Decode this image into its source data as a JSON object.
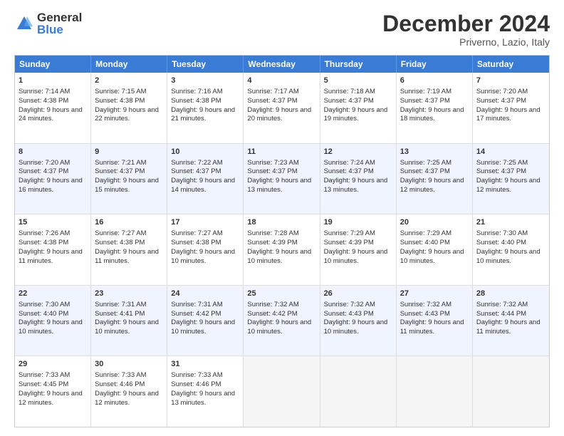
{
  "logo": {
    "general": "General",
    "blue": "Blue"
  },
  "title": "December 2024",
  "subtitle": "Priverno, Lazio, Italy",
  "headers": [
    "Sunday",
    "Monday",
    "Tuesday",
    "Wednesday",
    "Thursday",
    "Friday",
    "Saturday"
  ],
  "weeks": [
    [
      {
        "day": "1",
        "sunrise": "7:14 AM",
        "sunset": "4:38 PM",
        "daylight": "9 hours and 24 minutes."
      },
      {
        "day": "2",
        "sunrise": "7:15 AM",
        "sunset": "4:38 PM",
        "daylight": "9 hours and 22 minutes."
      },
      {
        "day": "3",
        "sunrise": "7:16 AM",
        "sunset": "4:38 PM",
        "daylight": "9 hours and 21 minutes."
      },
      {
        "day": "4",
        "sunrise": "7:17 AM",
        "sunset": "4:37 PM",
        "daylight": "9 hours and 20 minutes."
      },
      {
        "day": "5",
        "sunrise": "7:18 AM",
        "sunset": "4:37 PM",
        "daylight": "9 hours and 19 minutes."
      },
      {
        "day": "6",
        "sunrise": "7:19 AM",
        "sunset": "4:37 PM",
        "daylight": "9 hours and 18 minutes."
      },
      {
        "day": "7",
        "sunrise": "7:20 AM",
        "sunset": "4:37 PM",
        "daylight": "9 hours and 17 minutes."
      }
    ],
    [
      {
        "day": "8",
        "sunrise": "7:20 AM",
        "sunset": "4:37 PM",
        "daylight": "9 hours and 16 minutes."
      },
      {
        "day": "9",
        "sunrise": "7:21 AM",
        "sunset": "4:37 PM",
        "daylight": "9 hours and 15 minutes."
      },
      {
        "day": "10",
        "sunrise": "7:22 AM",
        "sunset": "4:37 PM",
        "daylight": "9 hours and 14 minutes."
      },
      {
        "day": "11",
        "sunrise": "7:23 AM",
        "sunset": "4:37 PM",
        "daylight": "9 hours and 13 minutes."
      },
      {
        "day": "12",
        "sunrise": "7:24 AM",
        "sunset": "4:37 PM",
        "daylight": "9 hours and 13 minutes."
      },
      {
        "day": "13",
        "sunrise": "7:25 AM",
        "sunset": "4:37 PM",
        "daylight": "9 hours and 12 minutes."
      },
      {
        "day": "14",
        "sunrise": "7:25 AM",
        "sunset": "4:37 PM",
        "daylight": "9 hours and 12 minutes."
      }
    ],
    [
      {
        "day": "15",
        "sunrise": "7:26 AM",
        "sunset": "4:38 PM",
        "daylight": "9 hours and 11 minutes."
      },
      {
        "day": "16",
        "sunrise": "7:27 AM",
        "sunset": "4:38 PM",
        "daylight": "9 hours and 11 minutes."
      },
      {
        "day": "17",
        "sunrise": "7:27 AM",
        "sunset": "4:38 PM",
        "daylight": "9 hours and 10 minutes."
      },
      {
        "day": "18",
        "sunrise": "7:28 AM",
        "sunset": "4:39 PM",
        "daylight": "9 hours and 10 minutes."
      },
      {
        "day": "19",
        "sunrise": "7:29 AM",
        "sunset": "4:39 PM",
        "daylight": "9 hours and 10 minutes."
      },
      {
        "day": "20",
        "sunrise": "7:29 AM",
        "sunset": "4:40 PM",
        "daylight": "9 hours and 10 minutes."
      },
      {
        "day": "21",
        "sunrise": "7:30 AM",
        "sunset": "4:40 PM",
        "daylight": "9 hours and 10 minutes."
      }
    ],
    [
      {
        "day": "22",
        "sunrise": "7:30 AM",
        "sunset": "4:40 PM",
        "daylight": "9 hours and 10 minutes."
      },
      {
        "day": "23",
        "sunrise": "7:31 AM",
        "sunset": "4:41 PM",
        "daylight": "9 hours and 10 minutes."
      },
      {
        "day": "24",
        "sunrise": "7:31 AM",
        "sunset": "4:42 PM",
        "daylight": "9 hours and 10 minutes."
      },
      {
        "day": "25",
        "sunrise": "7:32 AM",
        "sunset": "4:42 PM",
        "daylight": "9 hours and 10 minutes."
      },
      {
        "day": "26",
        "sunrise": "7:32 AM",
        "sunset": "4:43 PM",
        "daylight": "9 hours and 10 minutes."
      },
      {
        "day": "27",
        "sunrise": "7:32 AM",
        "sunset": "4:43 PM",
        "daylight": "9 hours and 11 minutes."
      },
      {
        "day": "28",
        "sunrise": "7:32 AM",
        "sunset": "4:44 PM",
        "daylight": "9 hours and 11 minutes."
      }
    ],
    [
      {
        "day": "29",
        "sunrise": "7:33 AM",
        "sunset": "4:45 PM",
        "daylight": "9 hours and 12 minutes."
      },
      {
        "day": "30",
        "sunrise": "7:33 AM",
        "sunset": "4:46 PM",
        "daylight": "9 hours and 12 minutes."
      },
      {
        "day": "31",
        "sunrise": "7:33 AM",
        "sunset": "4:46 PM",
        "daylight": "9 hours and 13 minutes."
      },
      null,
      null,
      null,
      null
    ]
  ],
  "labels": {
    "sunrise": "Sunrise:",
    "sunset": "Sunset:",
    "daylight": "Daylight:"
  }
}
